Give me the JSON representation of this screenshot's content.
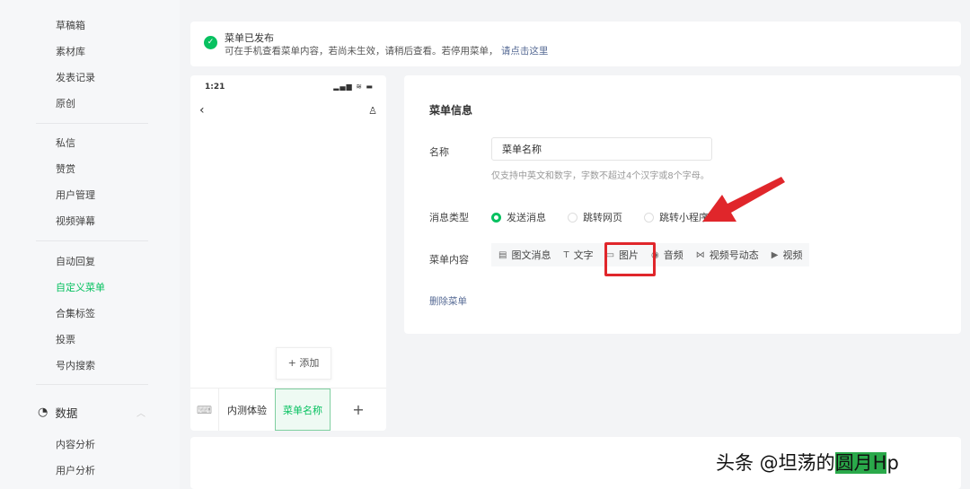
{
  "sidebar": {
    "items": [
      "草稿箱",
      "素材库",
      "发表记录",
      "原创",
      "私信",
      "赞赏",
      "用户管理",
      "视频弹幕",
      "自动回复",
      "自定义菜单",
      "合集标签",
      "投票",
      "号内搜索"
    ],
    "active": "自定义菜单",
    "group": {
      "label": "数据",
      "icon": "pie-chart-icon",
      "expanded": true
    },
    "group_items": [
      "内容分析",
      "用户分析"
    ]
  },
  "notice": {
    "title": "菜单已发布",
    "desc": "可在手机查看菜单内容，若尚未生效，请稍后查看。若停用菜单，",
    "link": "请点击这里"
  },
  "phone": {
    "time": "1:21",
    "status": "▂▄▆ ≋ ▬",
    "add_label": "+ 添加",
    "menus": [
      "内测体验",
      "菜单名称"
    ],
    "plus": "+"
  },
  "editor": {
    "title": "菜单信息",
    "name_label": "名称",
    "name_value": "菜单名称",
    "name_hint": "仅支持中英文和数字，字数不超过4个汉字或8个字母。",
    "type_label": "消息类型",
    "types": [
      "发送消息",
      "跳转网页",
      "跳转小程序"
    ],
    "content_label": "菜单内容",
    "content_tabs": [
      {
        "icon": "▤",
        "label": "图文消息"
      },
      {
        "icon": "T",
        "label": "文字"
      },
      {
        "icon": "▭",
        "label": "图片"
      },
      {
        "icon": "◉",
        "label": "音频"
      },
      {
        "icon": "⋈",
        "label": "视频号动态"
      },
      {
        "icon": "▶",
        "label": "视频"
      }
    ],
    "delete": "删除菜单"
  },
  "watermark": {
    "prefix": "头条 @坦荡的",
    "highlight": "圆月H",
    "suffix": "p"
  },
  "colors": {
    "accent": "#07c160",
    "link": "#576b95",
    "annotation": "#e0262b"
  }
}
